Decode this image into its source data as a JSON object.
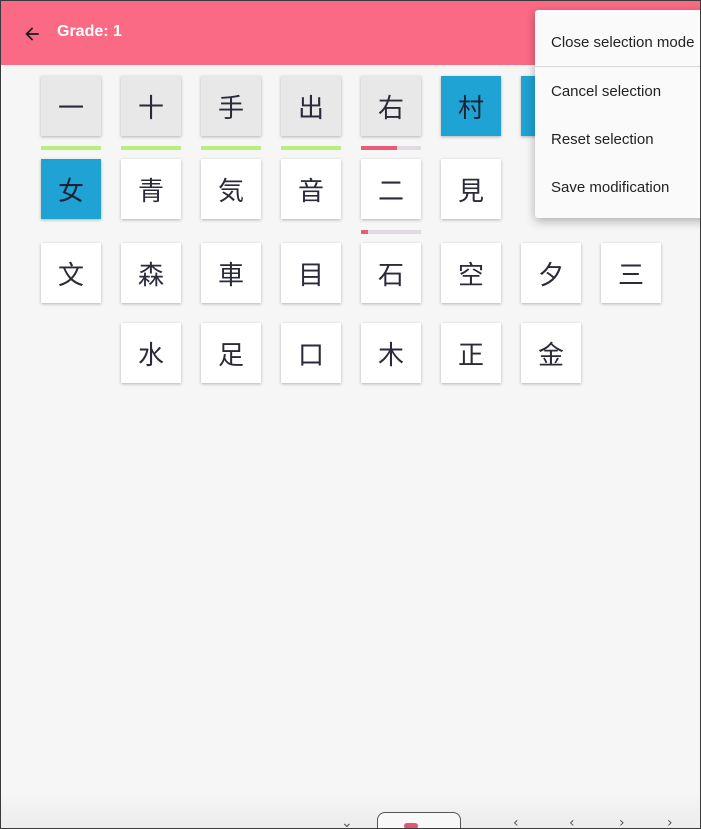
{
  "header": {
    "title": "Grade: 1",
    "background_color": "#fb6a85",
    "back_icon": "arrow-left-icon"
  },
  "colors": {
    "selected": "#1fa3d4",
    "learned_bar": "#b9ee7c",
    "partial_bar": "#e85c78",
    "bar_track": "#e3d9e3"
  },
  "kanji_rows": [
    [
      "一",
      "十",
      "手",
      "出",
      "右",
      "村",
      ""
    ],
    [
      "女",
      "青",
      "気",
      "音",
      "二",
      "見"
    ],
    [
      "文",
      "森",
      "車",
      "目",
      "石",
      "空",
      "夕",
      "三"
    ],
    [
      "水",
      "足",
      "口",
      "木",
      "正",
      "金"
    ]
  ],
  "tile_states": {
    "row0": [
      "grey",
      "grey",
      "grey",
      "grey",
      "grey",
      "selected",
      "selected"
    ],
    "row1": [
      "selected",
      "white",
      "white",
      "white",
      "white",
      "white"
    ]
  },
  "progress": {
    "row0": [
      1.0,
      1.0,
      1.0,
      1.0,
      0.6
    ],
    "row1_col4": 0.12
  },
  "menu": {
    "items": [
      "Close selection mode",
      "Cancel selection",
      "Reset selection",
      "Save modification"
    ]
  },
  "bottom_nav": {
    "icons": [
      "chevron-icon",
      "heart-icon",
      "prev-icon",
      "next-icon"
    ]
  }
}
